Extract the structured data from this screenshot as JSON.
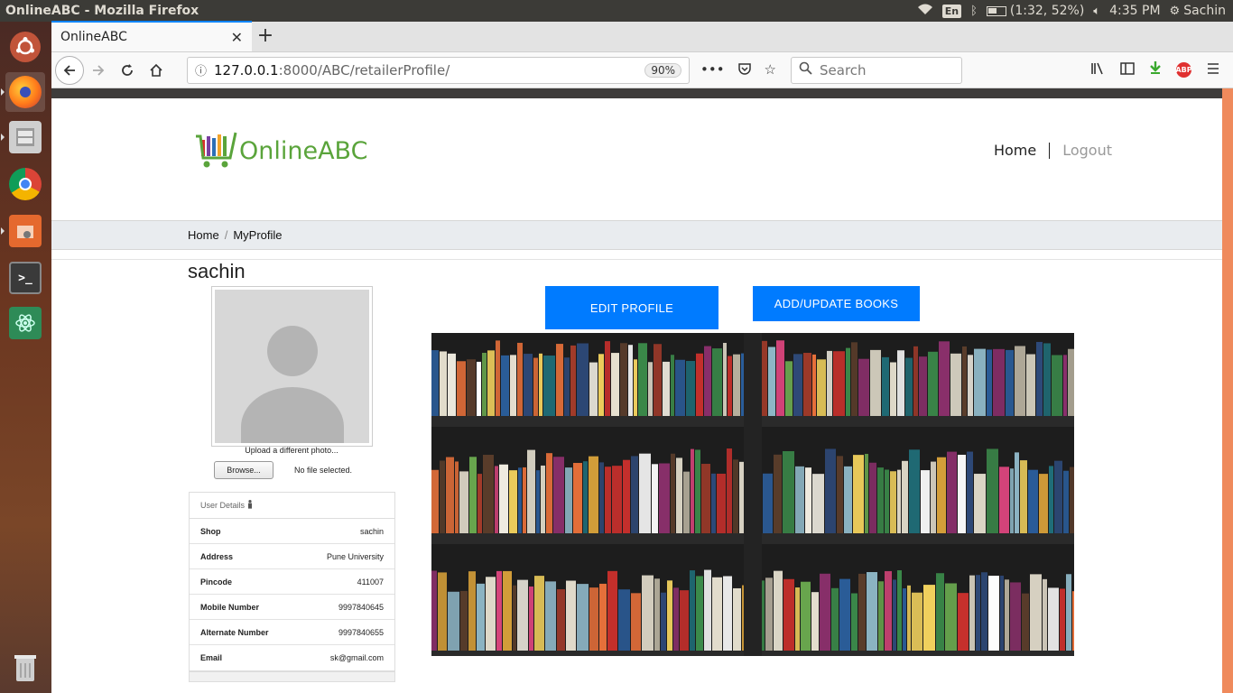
{
  "os": {
    "window_title": "OnlineABC - Mozilla Firefox",
    "indicators": {
      "language": "En",
      "battery_text": "(1:32, 52%)",
      "time": "4:35 PM",
      "user": "Sachin"
    },
    "launcher": [
      {
        "name": "ubuntu-dash-icon"
      },
      {
        "name": "firefox-icon"
      },
      {
        "name": "file-cabinet-icon"
      },
      {
        "name": "chrome-icon"
      },
      {
        "name": "file-manager-icon"
      },
      {
        "name": "terminal-icon"
      },
      {
        "name": "atom-editor-icon"
      },
      {
        "name": "trash-icon"
      }
    ]
  },
  "browser": {
    "tab_title": "OnlineABC",
    "url_host": "127.0.0.1",
    "url_rest": ":8000/ABC/retailerProfile/",
    "zoom": "90%",
    "search_placeholder": "Search",
    "toolbar_icons": [
      "library-icon",
      "sidebar-icon",
      "download-icon",
      "adblock-icon",
      "menu-icon"
    ],
    "abp_label": "ABP"
  },
  "site": {
    "logo_text": "OnlineABC",
    "nav": {
      "home": "Home",
      "logout": "Logout"
    },
    "breadcrumb": {
      "home": "Home",
      "separator": "/",
      "current": "MyProfile"
    },
    "profile": {
      "username": "sachin",
      "upload_label": "Upload a different photo...",
      "browse_label": "Browse...",
      "no_file": "No file selected."
    },
    "user_details": {
      "header": "User Details",
      "rows": [
        {
          "key": "Shop",
          "value": "sachin"
        },
        {
          "key": "Address",
          "value": "Pune University"
        },
        {
          "key": "Pincode",
          "value": "411007"
        },
        {
          "key": "Mobile Number",
          "value": "9997840645"
        },
        {
          "key": "Alternate Number",
          "value": "9997840655"
        },
        {
          "key": "Email",
          "value": "sk@gmail.com"
        }
      ]
    },
    "buttons": {
      "edit_profile": "EDIT PROFILE",
      "add_update_books": "ADD/UPDATE BOOKS"
    },
    "colors": {
      "primary": "#007bff",
      "logo_green": "#5aa43b",
      "breadcrumb_bg": "#e9ecef"
    }
  }
}
